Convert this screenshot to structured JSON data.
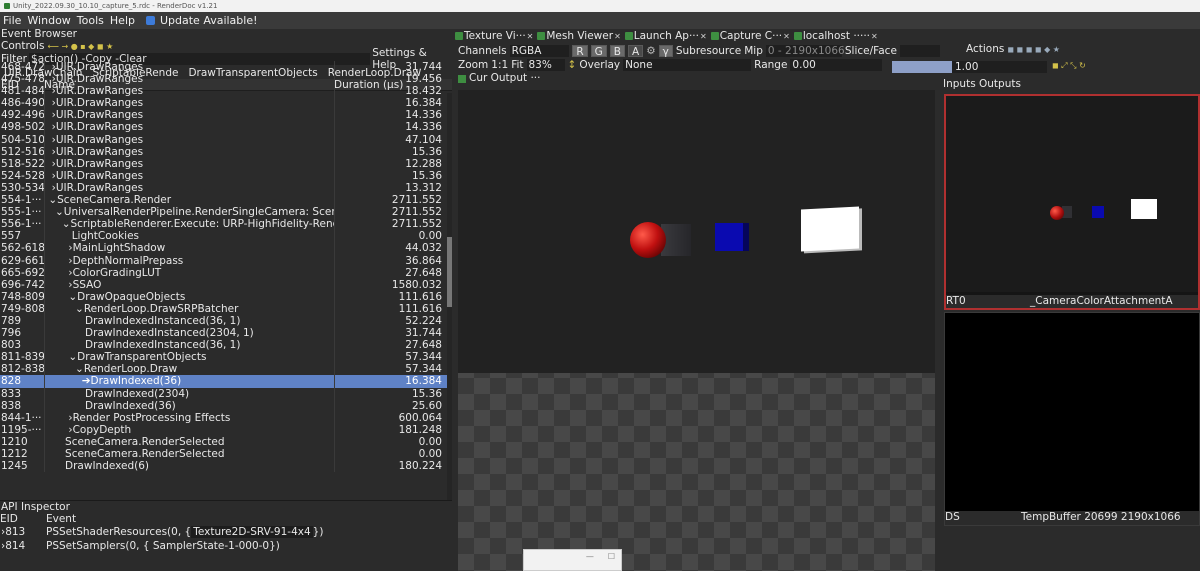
{
  "window": {
    "title": "Unity_2022.09.30_10.10_capture_5.rdc - RenderDoc v1.21"
  },
  "menu": {
    "items": [
      "File",
      "Window",
      "Tools",
      "Help"
    ],
    "update": "Update Available!"
  },
  "event_browser": {
    "title": "Event Browser",
    "controls": "Controls",
    "filter_label": "Filter",
    "filter_value": "$action() -Copy -Clear",
    "settings": "Settings & Help",
    "breadcrumbs": [
      "UIR.DrawChain",
      "ScriptableRende",
      "DrawTransparentObjects",
      "RenderLoop.Draw"
    ],
    "columns": [
      "EID",
      "Name",
      "Duration (µs)"
    ],
    "rows": [
      {
        "eid": "468-472",
        "name": "  ›UIR.DrawRanges",
        "dur": "31.744"
      },
      {
        "eid": "475-478",
        "name": "  ›UIR.DrawRanges",
        "dur": "19.456"
      },
      {
        "eid": "481-484",
        "name": "  ›UIR.DrawRanges",
        "dur": "18.432"
      },
      {
        "eid": "486-490",
        "name": "  ›UIR.DrawRanges",
        "dur": "16.384"
      },
      {
        "eid": "492-496",
        "name": "  ›UIR.DrawRanges",
        "dur": "14.336"
      },
      {
        "eid": "498-502",
        "name": "  ›UIR.DrawRanges",
        "dur": "14.336"
      },
      {
        "eid": "504-510",
        "name": "  ›UIR.DrawRanges",
        "dur": "47.104"
      },
      {
        "eid": "512-516",
        "name": "  ›UIR.DrawRanges",
        "dur": "15.36"
      },
      {
        "eid": "518-522",
        "name": "  ›UIR.DrawRanges",
        "dur": "12.288"
      },
      {
        "eid": "524-528",
        "name": "  ›UIR.DrawRanges",
        "dur": "15.36"
      },
      {
        "eid": "530-534",
        "name": "  ›UIR.DrawRanges",
        "dur": "13.312"
      },
      {
        "eid": "554-1···",
        "name": " ⌄SceneCamera.Render",
        "dur": "2711.552"
      },
      {
        "eid": "555-1···",
        "name": "   ⌄UniversalRenderPipeline.RenderSingleCamera: Scene···",
        "dur": "2711.552"
      },
      {
        "eid": "556-1···",
        "name": "     ⌄ScriptableRenderer.Execute: URP-HighFidelity-Rend···",
        "dur": "2711.552"
      },
      {
        "eid": "557",
        "name": "        LightCookies",
        "dur": "0.00"
      },
      {
        "eid": "562-618",
        "name": "       ›MainLightShadow",
        "dur": "44.032"
      },
      {
        "eid": "629-661",
        "name": "       ›DepthNormalPrepass",
        "dur": "36.864"
      },
      {
        "eid": "665-692",
        "name": "       ›ColorGradingLUT",
        "dur": "27.648"
      },
      {
        "eid": "696-742",
        "name": "       ›SSAO",
        "dur": "1580.032"
      },
      {
        "eid": "748-809",
        "name": "       ⌄DrawOpaqueObjects",
        "dur": "111.616"
      },
      {
        "eid": "749-808",
        "name": "         ⌄RenderLoop.DrawSRPBatcher",
        "dur": "111.616"
      },
      {
        "eid": "789",
        "name": "            DrawIndexedInstanced(36, 1)",
        "dur": "52.224"
      },
      {
        "eid": "796",
        "name": "            DrawIndexedInstanced(2304, 1)",
        "dur": "31.744"
      },
      {
        "eid": "803",
        "name": "            DrawIndexedInstanced(36, 1)",
        "dur": "27.648"
      },
      {
        "eid": "811-839",
        "name": "       ⌄DrawTransparentObjects",
        "dur": "57.344"
      },
      {
        "eid": "812-838",
        "name": "         ⌄RenderLoop.Draw",
        "dur": "57.344"
      },
      {
        "eid": "828",
        "name": "           ➔DrawIndexed(36)",
        "dur": "16.384",
        "sel": true
      },
      {
        "eid": "833",
        "name": "            DrawIndexed(2304)",
        "dur": "15.36"
      },
      {
        "eid": "838",
        "name": "            DrawIndexed(36)",
        "dur": "25.60"
      },
      {
        "eid": "844-1···",
        "name": "       ›Render PostProcessing Effects",
        "dur": "600.064"
      },
      {
        "eid": "1195-···",
        "name": "       ›CopyDepth",
        "dur": "181.248"
      },
      {
        "eid": "1210",
        "name": "      SceneCamera.RenderSelected",
        "dur": "0.00"
      },
      {
        "eid": "1212",
        "name": "      SceneCamera.RenderSelected",
        "dur": "0.00"
      },
      {
        "eid": "1245",
        "name": "      DrawIndexed(6)",
        "dur": "180.224"
      }
    ]
  },
  "api_inspector": {
    "title": "API Inspector",
    "columns": [
      "EID",
      "Event"
    ],
    "rows": [
      {
        "eid": "›813",
        "fn": "PSSetShaderResources(0, { ",
        "res": "Texture2D-SRV-91-4x4",
        "tail": " })"
      },
      {
        "eid": "›814",
        "fn": "PSSetSamplers(0, { SamplerState-1-000-0",
        "res": "",
        "tail": " })"
      }
    ]
  },
  "tabs": [
    {
      "label": "Texture Vi···"
    },
    {
      "label": "Mesh Viewer"
    },
    {
      "label": "Launch Ap···"
    },
    {
      "label": "Capture C···"
    },
    {
      "label": "localhost ·····"
    }
  ],
  "texture_viewer": {
    "channels_label": "Channels",
    "channels_value": "RGBA",
    "channel_buttons": [
      "R",
      "G",
      "B",
      "A",
      "γ"
    ],
    "subresource_label": "Subresource",
    "mip_label": "Mip",
    "mip_value": "0 - 2190x1066",
    "slice_label": "Slice/Face",
    "actions_label": "Actions",
    "zoom_label": "Zoom",
    "one_to_one": "1:1",
    "fit_label": "Fit",
    "zoom_value": "83%",
    "overlay_label": "Overlay",
    "overlay_value": "None",
    "range_label": "Range",
    "range_min": "0.00",
    "range_max": "1.00",
    "cur_output": "Cur Output ···"
  },
  "inputs_outputs": {
    "inputs": "Inputs",
    "outputs": "Outputs",
    "rt0_label": "RT0",
    "rt0_name": "_CameraColorAttachmentA",
    "ds_label": "DS",
    "ds_name": "TempBuffer 20699 2190x1066"
  },
  "colors": {
    "selection": "#5f82c6",
    "accent_green": "#3e8e41",
    "thumb_border": "#b03030"
  }
}
